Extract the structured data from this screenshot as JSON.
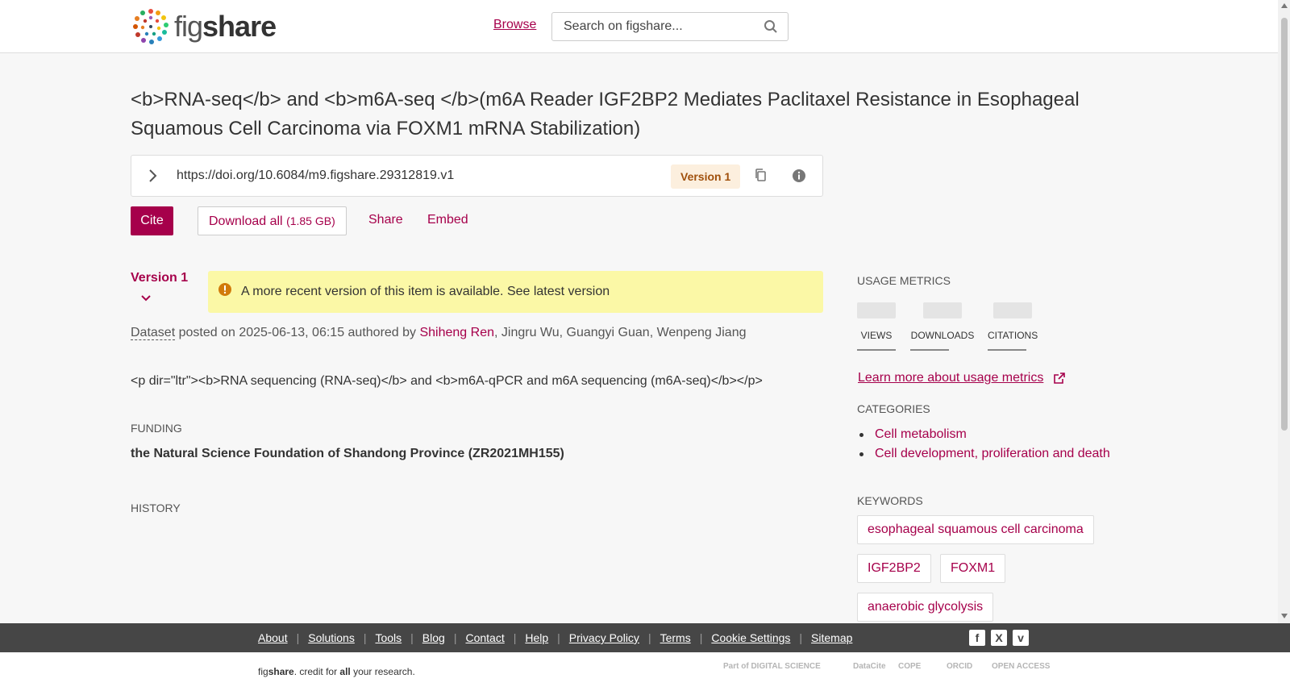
{
  "header": {
    "logo_prefix": "fig",
    "logo_suffix": "share",
    "browse_label": "Browse",
    "search_placeholder": "Search on figshare..."
  },
  "item": {
    "title": "<b>RNA-seq</b> and <b>m6A-seq </b>(m6A Reader IGF2BP2 Mediates Paclitaxel Resistance in Esophageal Squamous Cell Carcinoma via FOXM1 mRNA Stabilization)",
    "doi_url": "https://doi.org/10.6084/m9.figshare.29312819.v1",
    "version_badge": "Version 1"
  },
  "actions": {
    "cite": "Cite",
    "download_all": "Download all",
    "download_size": "(1.85 GB)",
    "share": "Share",
    "embed": "Embed"
  },
  "version_select": "Version 1",
  "notice": {
    "text": "A more recent version of this item is available.",
    "link": "See latest version"
  },
  "meta": {
    "type": "Dataset",
    "posted_text": " posted on 2025-06-13, 06:15 authored by ",
    "author_link": "Shiheng Ren",
    "other_authors": ", Jingru Wu, Guangyi Guan, Wenpeng Jiang"
  },
  "description": "<p dir=\"ltr\"><b>RNA sequencing (RNA-seq)</b> and <b>m6A-qPCR and m6A sequencing (m6A-seq)</b></p>",
  "funding": {
    "label": "FUNDING",
    "text": "the Natural Science Foundation of Shandong Province (ZR2021MH155)"
  },
  "history_label": "HISTORY",
  "usage": {
    "label": "USAGE METRICS",
    "metrics": [
      "VIEWS",
      "DOWNLOADS",
      "CITATIONS"
    ],
    "learn_more": "Learn more about usage metrics"
  },
  "categories": {
    "label": "CATEGORIES",
    "items": [
      "Cell metabolism",
      "Cell development, proliferation and death"
    ]
  },
  "keywords": {
    "label": "KEYWORDS",
    "items": [
      "esophageal squamous cell carcinoma",
      "IGF2BP2",
      "FOXM1",
      "anaerobic glycolysis"
    ]
  },
  "footer": {
    "links": [
      "About",
      "Solutions",
      "Tools",
      "Blog",
      "Contact",
      "Help",
      "Privacy Policy",
      "Terms",
      "Cookie Settings",
      "Sitemap"
    ],
    "social": [
      "f",
      "X",
      "v"
    ],
    "tagline_brand_a": "fig",
    "tagline_brand_b": "share",
    "tagline_mid": ". credit for ",
    "tagline_all": "all",
    "tagline_end": " your research.",
    "partners": [
      "Part of DIGITAL SCIENCE",
      "DataCite",
      "COPE",
      "ORCID",
      "OPEN ACCESS"
    ]
  },
  "colors": {
    "brand": "#a6004b",
    "notice_bg": "#fbf8a6",
    "footer_bg": "#464646"
  }
}
